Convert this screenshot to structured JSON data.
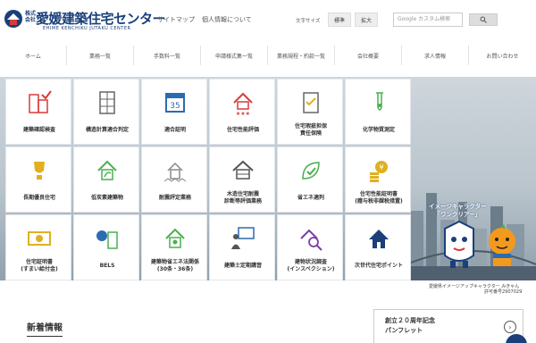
{
  "header": {
    "logo_small_top": "株式",
    "logo_small_bottom": "会社",
    "logo_main": "愛媛建築住宅センター",
    "logo_sub": "EHIME KENCHIKU JUTAKU CENTER",
    "sitemap": "サイトマップ",
    "privacy": "個人情報について",
    "font_size_label": "文字サイズ",
    "font_standard": "標準",
    "font_large": "拡大",
    "search_placeholder": "Google カスタム検索",
    "search_icon": "search-icon"
  },
  "nav": [
    "ホーム",
    "業務一覧",
    "手数料一覧",
    "申請様式集一覧",
    "業務規程・約款一覧",
    "会社概要",
    "求人情報",
    "お問い合わせ"
  ],
  "tiles": [
    {
      "label": "建築確認検査",
      "icon": "building-check-icon"
    },
    {
      "label": "構造計算適合判定",
      "icon": "structure-building-icon"
    },
    {
      "label": "適合証明",
      "icon": "calendar-35-icon"
    },
    {
      "label": "住宅性能評価",
      "icon": "house-stars-icon"
    },
    {
      "label": "住宅瑕疵担保\n責任保険",
      "icon": "clipboard-check-icon"
    },
    {
      "label": "化学物質測定",
      "icon": "test-tube-icon"
    },
    {
      "label": "長期優良住宅",
      "icon": "trophy-icon"
    },
    {
      "label": "低炭素建築物",
      "icon": "eco-house-icon"
    },
    {
      "label": "耐震評定業務",
      "icon": "quake-house-icon"
    },
    {
      "label": "木造住宅耐震\n診断等評価業務",
      "icon": "wooden-house-icon"
    },
    {
      "label": "省エネ適判",
      "icon": "leaf-check-icon"
    },
    {
      "label": "住宅性能証明書\n(贈与税非課税措置)",
      "icon": "yen-coins-icon"
    },
    {
      "label": "住宅証明書\n(すまい給付金)",
      "icon": "yen-bill-icon"
    },
    {
      "label": "BELS",
      "icon": "bels-building-icon"
    },
    {
      "label": "建築物省エネ法関係\n(30条・36条)",
      "icon": "eco-home-icon"
    },
    {
      "label": "建築士定期講習",
      "icon": "lecture-icon"
    },
    {
      "label": "建物状況調査\n(インスペクション)",
      "icon": "inspection-icon"
    },
    {
      "label": "次世代住宅ポイント",
      "icon": "next-gen-house-icon"
    }
  ],
  "mascot": {
    "title_line1": "イメージキャラクター",
    "title_line2": "「ワンクリアー」"
  },
  "credit": "愛媛県イメージアップキャラクター みきゃん",
  "permit": "許可番号2907029",
  "news": {
    "title": "新着情報"
  },
  "pamphlet": {
    "line1": "創立２０周年記念",
    "line2": "パンフレット",
    "arrow": "›"
  },
  "colors": {
    "brand": "#1a3f7a",
    "icon_red": "#d93a3a",
    "icon_green": "#4caf50",
    "icon_gold": "#e0b020",
    "icon_blue": "#2b6cb0"
  }
}
